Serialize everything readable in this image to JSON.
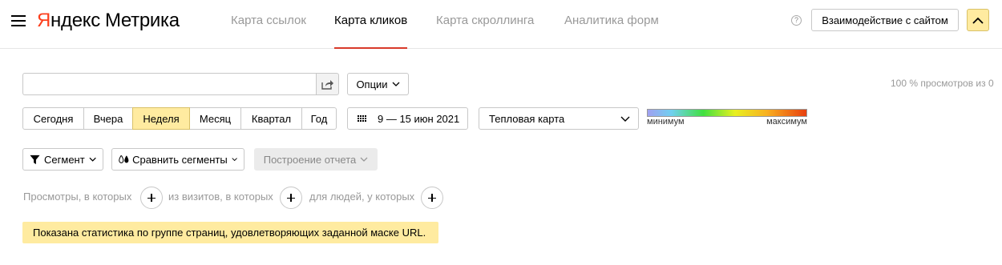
{
  "header": {
    "logo": {
      "brand_first": "Я",
      "brand_rest": "ндекс",
      "product": "Метрика"
    },
    "tabs": [
      {
        "label": "Карта ссылок",
        "active": false
      },
      {
        "label": "Карта кликов",
        "active": true
      },
      {
        "label": "Карта скроллинга",
        "active": false
      },
      {
        "label": "Аналитика форм",
        "active": false
      }
    ],
    "help_label": "?",
    "interact_button": "Взаимодействие с сайтом"
  },
  "toolbar": {
    "url_input_value": "",
    "options_label": "Опции",
    "views_info": "100 % просмотров из 0"
  },
  "periods": [
    "Сегодня",
    "Вчера",
    "Неделя",
    "Месяц",
    "Квартал",
    "Год"
  ],
  "selected_period": "Неделя",
  "date_range": "9 — 15 июн 2021",
  "map_type": "Тепловая карта",
  "legend": {
    "min": "минимум",
    "max": "максимум"
  },
  "segments": {
    "segment_label": "Сегмент",
    "compare_label": "Сравнить сегменты",
    "report_label": "Построение отчета"
  },
  "filters": {
    "views": "Просмотры, в которых",
    "visits": "из визитов, в которых",
    "people": "для людей, у которых"
  },
  "notice": "Показана статистика по группе страниц, удовлетворяющих заданной маске URL.",
  "colors": {
    "accent_yellow": "#ffeba0",
    "brand_red": "#fc3f1d",
    "active_tab_line": "#d83a2a"
  }
}
